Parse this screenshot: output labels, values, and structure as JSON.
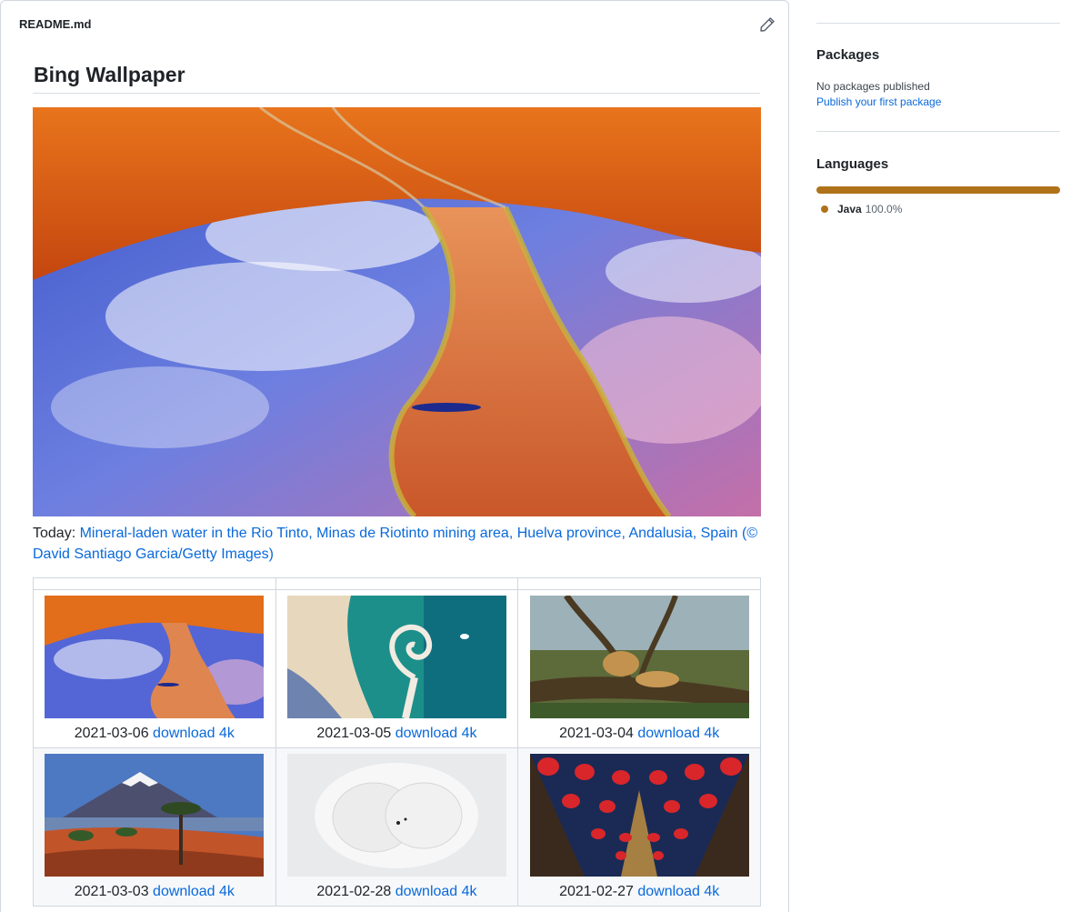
{
  "readme": {
    "filename": "README.md",
    "title": "Bing Wallpaper",
    "hero_alt": "Mineral-laden water in the Rio Tinto",
    "caption_prefix": "Today: ",
    "caption_link": "Mineral-laden water in the Rio Tinto, Minas de Riotinto mining area, Huelva province, Andalusia, Spain (© David Santiago Garcia/Getty Images)"
  },
  "wallpapers": [
    {
      "date": "2021-03-06",
      "link": "download 4k",
      "thumb": "rio-tinto"
    },
    {
      "date": "2021-03-05",
      "link": "download 4k",
      "thumb": "spiral-beach"
    },
    {
      "date": "2021-03-04",
      "link": "download 4k",
      "thumb": "lions-tree"
    },
    {
      "date": "2021-03-03",
      "link": "download 4k",
      "thumb": "volcano-araucaria"
    },
    {
      "date": "2021-02-28",
      "link": "download 4k",
      "thumb": "polar-bears"
    },
    {
      "date": "2021-02-27",
      "link": "download 4k",
      "thumb": "red-lanterns"
    }
  ],
  "sidebar": {
    "packages": {
      "heading": "Packages",
      "empty_text": "No packages published",
      "publish_link": "Publish your first package"
    },
    "languages": {
      "heading": "Languages",
      "items": [
        {
          "name": "Java",
          "percent": "100.0%",
          "color": "#b07219"
        }
      ]
    }
  },
  "colors": {
    "link": "#0969da",
    "border": "#d0d7de",
    "java": "#b07219"
  }
}
